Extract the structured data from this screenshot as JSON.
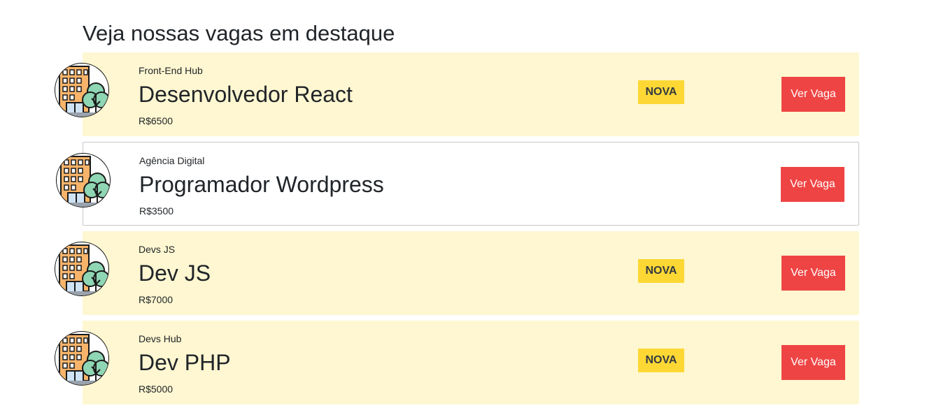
{
  "header": {
    "title": "Veja nossas vagas em destaque"
  },
  "jobs": [
    {
      "company": "Front-End Hub",
      "title": "Desenvolvedor React",
      "salary": "R$6500",
      "badge": "NOVA",
      "featured": true,
      "button_label": "Ver Vaga",
      "logo_icon": "office-building-icon"
    },
    {
      "company": "Agência Digital",
      "title": "Programador Wordpress",
      "salary": "R$3500",
      "badge": "",
      "featured": false,
      "button_label": "Ver Vaga",
      "logo_icon": "office-building-icon"
    },
    {
      "company": "Devs JS",
      "title": "Dev JS",
      "salary": "R$7000",
      "badge": "NOVA",
      "featured": true,
      "button_label": "Ver Vaga",
      "logo_icon": "office-building-icon"
    },
    {
      "company": "Devs Hub",
      "title": "Dev PHP",
      "salary": "R$5000",
      "badge": "NOVA",
      "featured": true,
      "button_label": "Ver Vaga",
      "logo_icon": "office-building-icon"
    }
  ],
  "colors": {
    "featured_background": "#fff7d1",
    "badge_background": "#fdd835",
    "button_background": "#ef4444",
    "text": "#212529"
  }
}
